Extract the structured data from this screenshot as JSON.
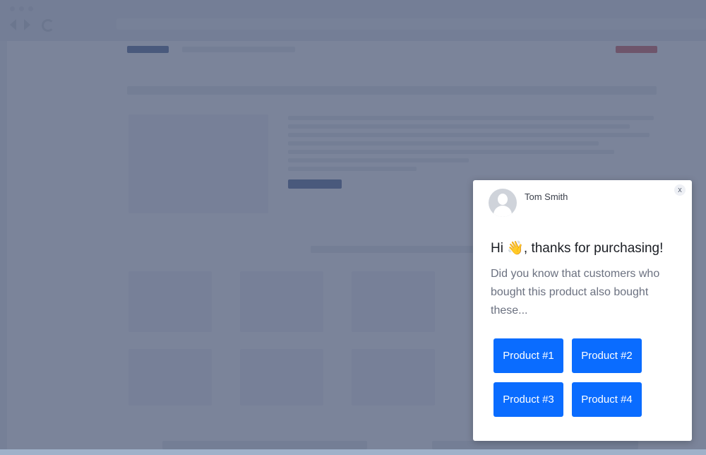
{
  "popup": {
    "sender_name": "Tom Smith",
    "close_label": "x",
    "greeting_prefix": "Hi ",
    "wave_glyph": "👋",
    "greeting_suffix": ", thanks for purchasing!",
    "message": "Did you know that customers who bought this product also bought these...",
    "products": [
      {
        "label": "Product #1"
      },
      {
        "label": "Product #2"
      },
      {
        "label": "Product #3"
      },
      {
        "label": "Product #4"
      }
    ]
  },
  "colors": {
    "button": "#0a6cff",
    "overlay": "#56617d",
    "page_accent_dark": "#1f3d77",
    "page_accent_red": "#c42a2a"
  },
  "icons": [
    "close-icon",
    "avatar-icon",
    "wave-icon",
    "back-arrow-icon",
    "forward-arrow-icon",
    "reload-icon"
  ]
}
